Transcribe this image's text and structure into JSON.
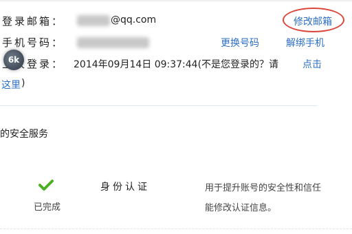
{
  "account": {
    "email_label": "登录邮箱：",
    "email_value": "@qq.com",
    "email_change_link": "修改邮箱",
    "phone_label": "手机号码：",
    "phone_change_link": "更换号码",
    "phone_unbind_link": "解绑手机",
    "last_login_label": "上次登录：",
    "last_login_value": "2014年09月14日 09:37:44(不是您登录的？请",
    "last_login_link_1": "点击",
    "last_login_link_2": "这里",
    "last_login_close": ")"
  },
  "security": {
    "section_title": "的安全服务",
    "items": [
      {
        "icon": "check-icon",
        "status": "已完成",
        "name": "身份认证",
        "desc_line1": "用于提升账号的安全性和信任",
        "desc_line2": "能修改认证信息。"
      }
    ]
  },
  "overlay": {
    "avatar_text": "6k"
  },
  "colors": {
    "link": "#2d6fc4",
    "check": "#4caf24",
    "highlight_ring": "#d9453b"
  }
}
